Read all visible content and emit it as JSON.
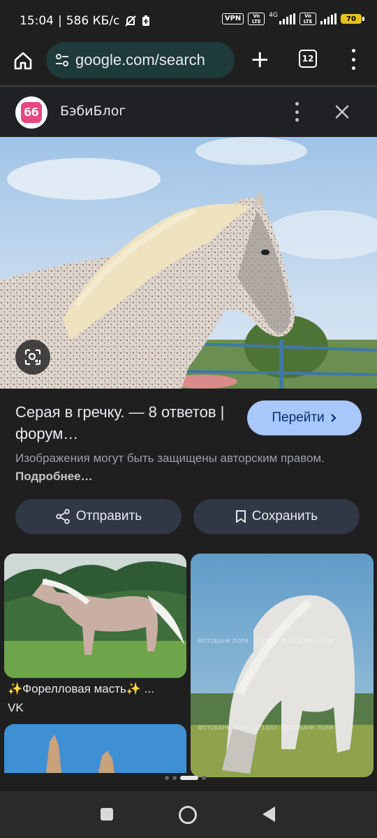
{
  "status_bar": {
    "time": "15:04",
    "speed": "586 КБ/с",
    "vpn": "VPN",
    "volte1": "Vo LTE",
    "net": "4G",
    "volte2": "Vo LTE",
    "battery": "70"
  },
  "browser": {
    "url": "google.com/search",
    "tabs_count": "12"
  },
  "source": {
    "logo_text": "бб",
    "name": "БэбиБлог"
  },
  "result": {
    "title": "Серая в гречку. — 8 ответов | форум…",
    "visit_label": "Перейти",
    "copyright_text": "Изображения могут быть защищены авторским правом.",
    "more_link": "Подробнее…",
    "share_label": "Отправить",
    "save_label": "Сохранить"
  },
  "related": [
    {
      "caption": "✨Форелловая масть✨ ...",
      "source": "VK"
    },
    {
      "caption": "",
      "source": ""
    },
    {
      "caption": "",
      "source": ""
    }
  ],
  "colors": {
    "accent": "#a8c7fa",
    "chip": "#303846",
    "logo": "#e8477f"
  }
}
